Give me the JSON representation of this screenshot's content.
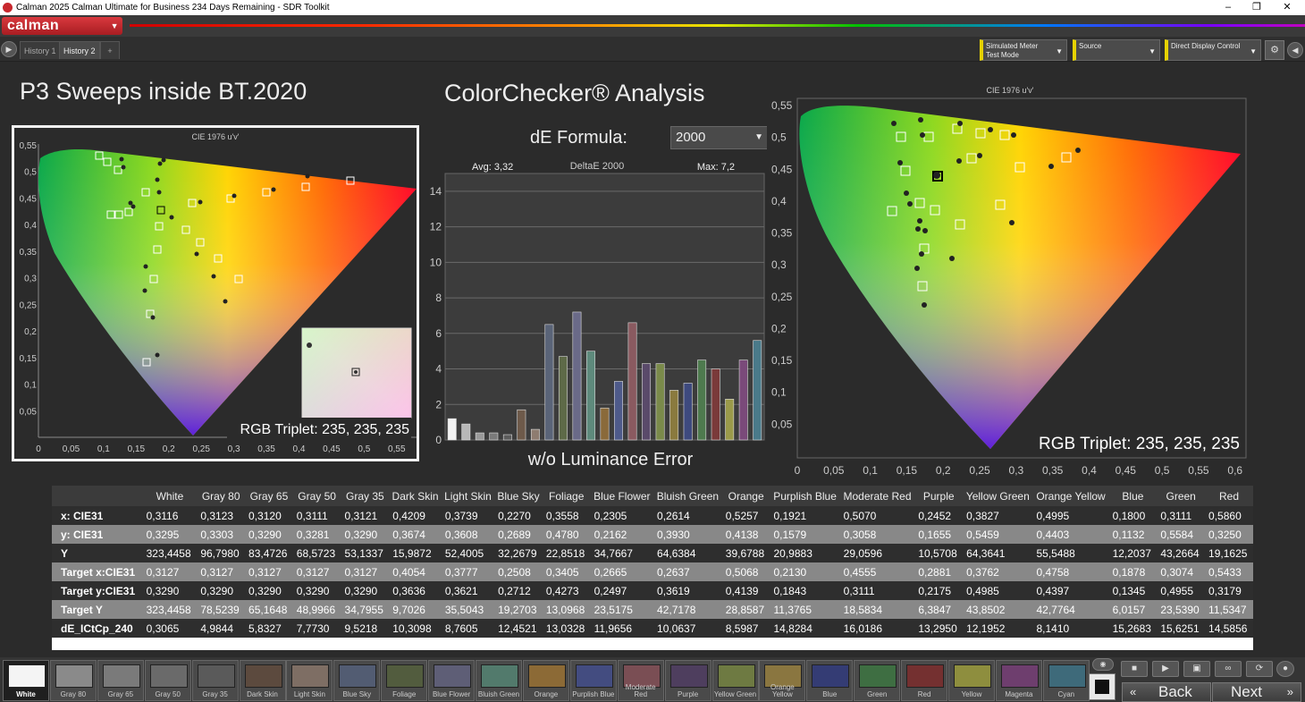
{
  "window": {
    "title": "Calman 2025 Calman Ultimate for Business 234 Days Remaining  -  SDR Toolkit"
  },
  "logo": {
    "text": "calman"
  },
  "tabs": [
    {
      "label": "History 1"
    },
    {
      "label": "History 2"
    },
    {
      "label": "+"
    }
  ],
  "toolbar": {
    "meter": {
      "line1": "Simulated Meter",
      "line2": "Test Mode"
    },
    "source": {
      "label": "Source"
    },
    "display": {
      "label": "Direct Display Control"
    }
  },
  "left_title": "P3 Sweeps inside BT.2020",
  "center_title": "ColorChecker® Analysis",
  "formula": {
    "label": "dE Formula:",
    "value": "2000"
  },
  "bar_chart": {
    "avg_label": "Avg: 3,32",
    "title": "DeltaE 2000",
    "max_label": "Max: 7,2",
    "footer": "w/o Luminance Error"
  },
  "cie_left": {
    "title": "CIE 1976 u'v'",
    "rgb_triplet": "RGB Triplet: 235, 235, 235"
  },
  "cie_right": {
    "title": "CIE 1976 u'v'",
    "rgb_triplet": "RGB Triplet: 235, 235, 235"
  },
  "chart_data": [
    {
      "type": "bar",
      "title": "DeltaE 2000",
      "xlabel": "w/o Luminance Error",
      "ylim": [
        0,
        15
      ],
      "yticks": [
        0,
        2,
        4,
        6,
        8,
        10,
        12,
        14
      ],
      "categories": [
        "White",
        "Gray 80",
        "Gray 65",
        "Gray 50",
        "Gray 35",
        "Dark Skin",
        "Light Skin",
        "Blue Sky",
        "Foliage",
        "Blue Flower",
        "Bluish Green",
        "Orange",
        "Purplish Blue",
        "Moderate Red",
        "Purple",
        "Yellow Green",
        "Orange Yellow",
        "Blue",
        "Green",
        "Red",
        "Yellow",
        "Magenta",
        "Cyan"
      ],
      "values": [
        1.2,
        0.9,
        0.4,
        0.4,
        0.3,
        1.7,
        0.6,
        6.5,
        4.7,
        7.2,
        5.0,
        1.8,
        3.3,
        6.6,
        4.3,
        4.3,
        2.8,
        3.2,
        4.5,
        4.0,
        2.3,
        4.5,
        5.6
      ],
      "colors": [
        "#f2f2f2",
        "#b8b8b8",
        "#999999",
        "#7a7a7a",
        "#5c5c5c",
        "#6e5a4a",
        "#8e7c70",
        "#5a6478",
        "#5e6a48",
        "#6a6a88",
        "#5e8a7c",
        "#8a6a3a",
        "#4e5a8a",
        "#8a5a60",
        "#5a4a6a",
        "#7a8a4a",
        "#8a7a3e",
        "#3e4a7e",
        "#4e7a4e",
        "#7a3a3a",
        "#9a9a4a",
        "#7a4a7a",
        "#4a7a8a"
      ]
    },
    {
      "type": "scatter",
      "title": "CIE 1976 u'v'",
      "xlim": [
        0,
        0.58
      ],
      "ylim": [
        0,
        0.6
      ],
      "xticks": [
        "0",
        "0,05",
        "0,1",
        "0,15",
        "0,2",
        "0,25",
        "0,3",
        "0,35",
        "0,4",
        "0,45",
        "0,5",
        "0,55"
      ],
      "yticks": [
        "0,05",
        "0,1",
        "0,15",
        "0,2",
        "0,25",
        "0,3",
        "0,35",
        "0,4",
        "0,45",
        "0,5",
        "0,55"
      ]
    },
    {
      "type": "scatter",
      "title": "CIE 1976 u'v'",
      "xlim": [
        0,
        0.63
      ],
      "ylim": [
        0,
        0.58
      ],
      "xticks": [
        "0",
        "0,05",
        "0,1",
        "0,15",
        "0,2",
        "0,25",
        "0,3",
        "0,35",
        "0,4",
        "0,45",
        "0,5",
        "0,55",
        "0,6"
      ],
      "yticks": [
        "0,05",
        "0,1",
        "0,15",
        "0,2",
        "0,25",
        "0,3",
        "0,35",
        "0,4",
        "0,45",
        "0,5",
        "0,55"
      ]
    }
  ],
  "table": {
    "columns": [
      "",
      "White",
      "Gray 80",
      "Gray 65",
      "Gray 50",
      "Gray 35",
      "Dark Skin",
      "Light Skin",
      "Blue Sky",
      "Foliage",
      "Blue Flower",
      "Bluish Green",
      "Orange",
      "Purplish Blue",
      "Moderate Red",
      "Purple",
      "Yellow Green",
      "Orange Yellow",
      "Blue",
      "Green",
      "Red"
    ],
    "rows": [
      {
        "label": "x: CIE31",
        "cells": [
          "0,3116",
          "0,3123",
          "0,3120",
          "0,3111",
          "0,3121",
          "0,4209",
          "0,3739",
          "0,2270",
          "0,3558",
          "0,2305",
          "0,2614",
          "0,5257",
          "0,1921",
          "0,5070",
          "0,2452",
          "0,3827",
          "0,4995",
          "0,1800",
          "0,3111",
          "0,5860"
        ]
      },
      {
        "label": "y: CIE31",
        "cells": [
          "0,3295",
          "0,3303",
          "0,3290",
          "0,3281",
          "0,3290",
          "0,3674",
          "0,3608",
          "0,2689",
          "0,4780",
          "0,2162",
          "0,3930",
          "0,4138",
          "0,1579",
          "0,3058",
          "0,1655",
          "0,5459",
          "0,4403",
          "0,1132",
          "0,5584",
          "0,3250"
        ]
      },
      {
        "label": "Y",
        "cells": [
          "323,4458",
          "96,7980",
          "83,4726",
          "68,5723",
          "53,1337",
          "15,9872",
          "52,4005",
          "32,2679",
          "22,8518",
          "34,7667",
          "64,6384",
          "39,6788",
          "20,9883",
          "29,0596",
          "10,5708",
          "64,3641",
          "55,5488",
          "12,2037",
          "43,2664",
          "19,1625"
        ]
      },
      {
        "label": "Target x:CIE31",
        "cells": [
          "0,3127",
          "0,3127",
          "0,3127",
          "0,3127",
          "0,3127",
          "0,4054",
          "0,3777",
          "0,2508",
          "0,3405",
          "0,2665",
          "0,2637",
          "0,5068",
          "0,2130",
          "0,4555",
          "0,2881",
          "0,3762",
          "0,4758",
          "0,1878",
          "0,3074",
          "0,5433"
        ]
      },
      {
        "label": "Target y:CIE31",
        "cells": [
          "0,3290",
          "0,3290",
          "0,3290",
          "0,3290",
          "0,3290",
          "0,3636",
          "0,3621",
          "0,2712",
          "0,4273",
          "0,2497",
          "0,3619",
          "0,4139",
          "0,1843",
          "0,3111",
          "0,2175",
          "0,4985",
          "0,4397",
          "0,1345",
          "0,4955",
          "0,3179"
        ]
      },
      {
        "label": "Target Y",
        "cells": [
          "323,4458",
          "78,5239",
          "65,1648",
          "48,9966",
          "34,7955",
          "9,7026",
          "35,5043",
          "19,2703",
          "13,0968",
          "23,5175",
          "42,7178",
          "28,8587",
          "11,3765",
          "18,5834",
          "6,3847",
          "43,8502",
          "42,7764",
          "6,0157",
          "23,5390",
          "11,5347"
        ]
      },
      {
        "label": "dE_ICtCp_240",
        "cells": [
          "0,3065",
          "4,9844",
          "5,8327",
          "7,7730",
          "9,5218",
          "10,3098",
          "8,7605",
          "12,4521",
          "13,0328",
          "11,9656",
          "10,0637",
          "8,5987",
          "14,8284",
          "16,0186",
          "13,2950",
          "12,1952",
          "8,1410",
          "15,2683",
          "15,6251",
          "14,5856"
        ]
      }
    ]
  },
  "swatches": [
    {
      "label": "White",
      "color": "#f4f4f4"
    },
    {
      "label": "Gray 80",
      "color": "#8a8a8a"
    },
    {
      "label": "Gray 65",
      "color": "#7a7a7a"
    },
    {
      "label": "Gray 50",
      "color": "#6a6a6a"
    },
    {
      "label": "Gray 35",
      "color": "#5a5a5a"
    },
    {
      "label": "Dark Skin",
      "color": "#5c4a3e"
    },
    {
      "label": "Light Skin",
      "color": "#7e6e64"
    },
    {
      "label": "Blue Sky",
      "color": "#525c72"
    },
    {
      "label": "Foliage",
      "color": "#525c3e"
    },
    {
      "label": "Blue Flower",
      "color": "#5e5e76"
    },
    {
      "label": "Bluish Green",
      "color": "#527a6c"
    },
    {
      "label": "Orange",
      "color": "#8c6a36"
    },
    {
      "label": "Purplish Blue",
      "color": "#434c80"
    },
    {
      "label": "Moderate Red",
      "color": "#7a4e54"
    },
    {
      "label": "Purple",
      "color": "#4e3e5e"
    },
    {
      "label": "Yellow Green",
      "color": "#6e7a42"
    },
    {
      "label": "Orange Yellow",
      "color": "#8a7640"
    },
    {
      "label": "Blue",
      "color": "#343c74"
    },
    {
      "label": "Green",
      "color": "#3e6e42"
    },
    {
      "label": "Red",
      "color": "#743030"
    },
    {
      "label": "Yellow",
      "color": "#8e8e3e"
    },
    {
      "label": "Magenta",
      "color": "#6e3e6e"
    },
    {
      "label": "Cyan",
      "color": "#3e6a7a"
    }
  ],
  "nav": {
    "back": "Back",
    "next": "Next"
  }
}
